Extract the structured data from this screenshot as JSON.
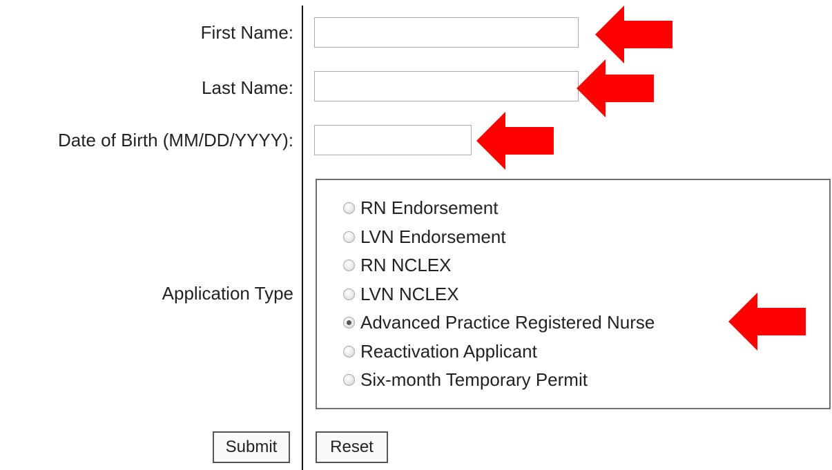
{
  "form": {
    "first_name": {
      "label": "First Name:",
      "value": "",
      "placeholder": ""
    },
    "last_name": {
      "label": "Last Name:",
      "value": "",
      "placeholder": ""
    },
    "dob": {
      "label": "Date of Birth (MM/DD/YYYY):",
      "value": "",
      "placeholder": ""
    },
    "application_type": {
      "label": "Application Type",
      "options": [
        {
          "label": "RN Endorsement",
          "checked": false
        },
        {
          "label": "LVN Endorsement",
          "checked": false
        },
        {
          "label": "RN NCLEX",
          "checked": false
        },
        {
          "label": "LVN NCLEX",
          "checked": false
        },
        {
          "label": "Advanced Practice Registered Nurse",
          "checked": true
        },
        {
          "label": "Reactivation Applicant",
          "checked": false
        },
        {
          "label": "Six-month Temporary Permit",
          "checked": false
        }
      ]
    },
    "submit_label": "Submit",
    "reset_label": "Reset"
  },
  "annotation": {
    "arrow_color": "#ff0000",
    "arrow_icon": "arrow-left-icon"
  }
}
